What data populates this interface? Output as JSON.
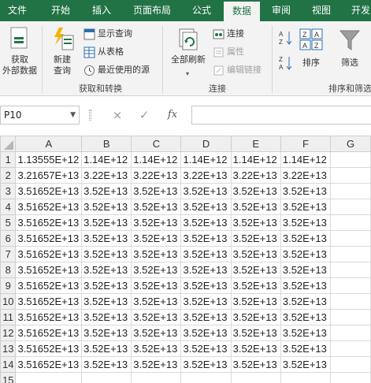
{
  "tabs": [
    "文件",
    "开始",
    "插入",
    "页面布局",
    "公式",
    "数据",
    "审阅",
    "视图",
    "开发"
  ],
  "active_tab": "数据",
  "ribbon": {
    "get_external": "获取\n外部数据",
    "new_query": "新建\n查询",
    "show_queries": "显示查询",
    "from_table": "从表格",
    "recent_sources": "最近使用的源",
    "group_get_transform": "获取和转换",
    "refresh_all": "全部刷新",
    "connections": "连接",
    "properties": "属性",
    "edit_links": "编辑链接",
    "group_connections": "连接",
    "sort": "排序",
    "filter": "筛选",
    "group_sort_filter": "排序和筛选"
  },
  "formula_bar": {
    "name_box": "P10",
    "cancel": "×",
    "enter": "✓",
    "fx": "fx",
    "content": ""
  },
  "sheet": {
    "columns": [
      "A",
      "B",
      "C",
      "D",
      "E",
      "F",
      "G"
    ],
    "rows": [
      {
        "n": "1",
        "cells": [
          "1.13555E+12",
          "1.14E+12",
          "1.14E+12",
          "1.14E+12",
          "1.14E+12",
          "1.14E+12",
          ""
        ]
      },
      {
        "n": "2",
        "cells": [
          "3.21657E+13",
          "3.22E+13",
          "3.22E+13",
          "3.22E+13",
          "3.22E+13",
          "3.22E+13",
          ""
        ]
      },
      {
        "n": "3",
        "cells": [
          "3.51652E+13",
          "3.52E+13",
          "3.52E+13",
          "3.52E+13",
          "3.52E+13",
          "3.52E+13",
          ""
        ]
      },
      {
        "n": "4",
        "cells": [
          "3.51652E+13",
          "3.52E+13",
          "3.52E+13",
          "3.52E+13",
          "3.52E+13",
          "3.52E+13",
          ""
        ]
      },
      {
        "n": "5",
        "cells": [
          "3.51652E+13",
          "3.52E+13",
          "3.52E+13",
          "3.52E+13",
          "3.52E+13",
          "3.52E+13",
          ""
        ]
      },
      {
        "n": "6",
        "cells": [
          "3.51652E+13",
          "3.52E+13",
          "3.52E+13",
          "3.52E+13",
          "3.52E+13",
          "3.52E+13",
          ""
        ]
      },
      {
        "n": "7",
        "cells": [
          "3.51652E+13",
          "3.52E+13",
          "3.52E+13",
          "3.52E+13",
          "3.52E+13",
          "3.52E+13",
          ""
        ]
      },
      {
        "n": "8",
        "cells": [
          "3.51652E+13",
          "3.52E+13",
          "3.52E+13",
          "3.52E+13",
          "3.52E+13",
          "3.52E+13",
          ""
        ]
      },
      {
        "n": "9",
        "cells": [
          "3.51652E+13",
          "3.52E+13",
          "3.52E+13",
          "3.52E+13",
          "3.52E+13",
          "3.52E+13",
          ""
        ]
      },
      {
        "n": "10",
        "cells": [
          "3.51652E+13",
          "3.52E+13",
          "3.52E+13",
          "3.52E+13",
          "3.52E+13",
          "3.52E+13",
          ""
        ]
      },
      {
        "n": "11",
        "cells": [
          "3.51652E+13",
          "3.52E+13",
          "3.52E+13",
          "3.52E+13",
          "3.52E+13",
          "3.52E+13",
          ""
        ]
      },
      {
        "n": "12",
        "cells": [
          "3.51652E+13",
          "3.52E+13",
          "3.52E+13",
          "3.52E+13",
          "3.52E+13",
          "3.52E+13",
          ""
        ]
      },
      {
        "n": "13",
        "cells": [
          "3.51652E+13",
          "3.52E+13",
          "3.52E+13",
          "3.52E+13",
          "3.52E+13",
          "3.52E+13",
          ""
        ]
      },
      {
        "n": "14",
        "cells": [
          "3.51652E+13",
          "3.52E+13",
          "3.52E+13",
          "3.52E+13",
          "3.52E+13",
          "3.52E+13",
          ""
        ]
      },
      {
        "n": "15",
        "cells": [
          "",
          "",
          "",
          "",
          "",
          "",
          ""
        ]
      }
    ]
  },
  "colors": {
    "brand_green": "#217346",
    "ribbon_bg": "#f3f3f3",
    "grid_line": "#d9d9d9"
  },
  "icons": [
    "get-data-icon",
    "new-query-icon",
    "show-queries-icon",
    "from-table-icon",
    "recent-sources-icon",
    "refresh-all-icon",
    "connections-icon",
    "properties-icon",
    "edit-links-icon",
    "sort-az-icon",
    "sort-za-icon",
    "sort-icon",
    "filter-icon",
    "cancel-icon",
    "enter-icon",
    "fx-icon"
  ]
}
